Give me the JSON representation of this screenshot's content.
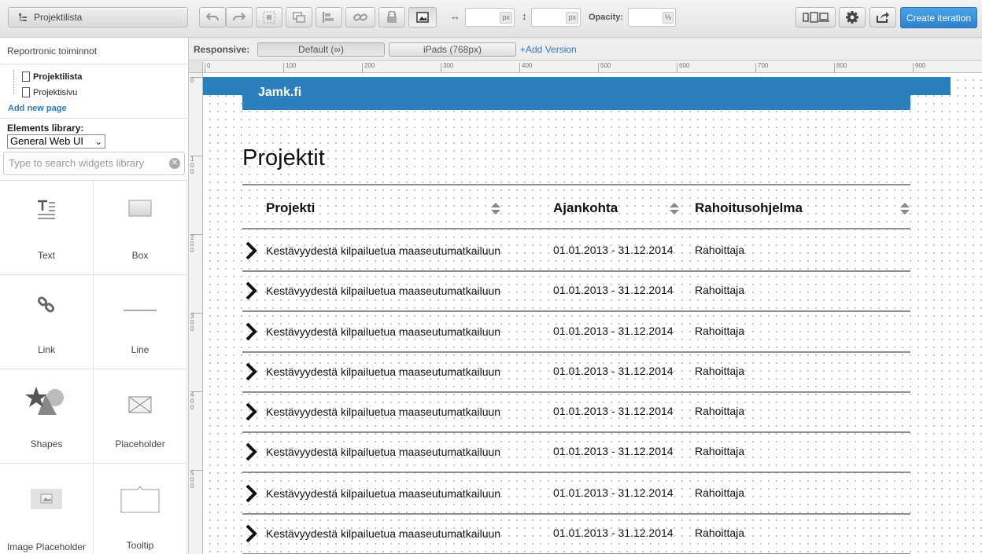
{
  "toolbar": {
    "page_select": "Projektilista",
    "opacity_label": "Opacity:",
    "width_unit": "px",
    "height_unit": "px",
    "opacity_unit": "%",
    "width_symbol": "↔",
    "height_symbol": "↕",
    "create_label": "Create iteration"
  },
  "left": {
    "project_name": "Reportronic toiminnot",
    "pages": [
      "Projektilista",
      "Projektisivu"
    ],
    "add_page": "Add new page",
    "library_label": "Elements library:",
    "library_value": "General Web UI",
    "search_placeholder": "Type to search widgets library",
    "widgets": [
      "Text",
      "Box",
      "Link",
      "Line",
      "Shapes",
      "Placeholder",
      "Image Placeholder",
      "Tooltip"
    ]
  },
  "responsive": {
    "label": "Responsive:",
    "versions": [
      "Default (∞)",
      "iPads (768px)"
    ],
    "add_version": "+Add Version"
  },
  "rulers": {
    "h": [
      "0",
      "100",
      "200",
      "300",
      "400",
      "500",
      "600",
      "700",
      "800",
      "900"
    ],
    "v": [
      "0",
      "100",
      "200",
      "300",
      "400",
      "500"
    ]
  },
  "canvas": {
    "site_title": "Jamk.fi",
    "heading": "Projektit",
    "columns": [
      "Projekti",
      "Ajankohta",
      "Rahoitusohjelma"
    ],
    "rows": [
      {
        "project": "Kestävyydestä kilpailuetua maaseutumatkailuun",
        "period": "01.01.2013 - 31.12.2014",
        "funding": "Rahoittaja"
      },
      {
        "project": "Kestävyydestä kilpailuetua maaseutumatkailuun",
        "period": "01.01.2013 - 31.12.2014",
        "funding": "Rahoittaja"
      },
      {
        "project": "Kestävyydestä kilpailuetua maaseutumatkailuun",
        "period": "01.01.2013 - 31.12.2014",
        "funding": "Rahoittaja"
      },
      {
        "project": "Kestävyydestä kilpailuetua maaseutumatkailuun",
        "period": "01.01.2013 - 31.12.2014",
        "funding": "Rahoittaja"
      },
      {
        "project": "Kestävyydestä kilpailuetua maaseutumatkailuun",
        "period": "01.01.2013 - 31.12.2014",
        "funding": "Rahoittaja"
      },
      {
        "project": "Kestävyydestä kilpailuetua maaseutumatkailuun",
        "period": "01.01.2013 - 31.12.2014",
        "funding": "Rahoittaja"
      },
      {
        "project": "Kestävyydestä kilpailuetua maaseutumatkailuun",
        "period": "01.01.2013 - 31.12.2014",
        "funding": "Rahoittaja"
      },
      {
        "project": "Kestävyydestä kilpailuetua maaseutumatkailuun",
        "period": "01.01.2013 - 31.12.2014",
        "funding": "Rahoittaja"
      }
    ]
  },
  "colors": {
    "header_blue": "#2c7fbd",
    "accent_button": "#2c82cc",
    "link_blue": "#2f78c4"
  }
}
